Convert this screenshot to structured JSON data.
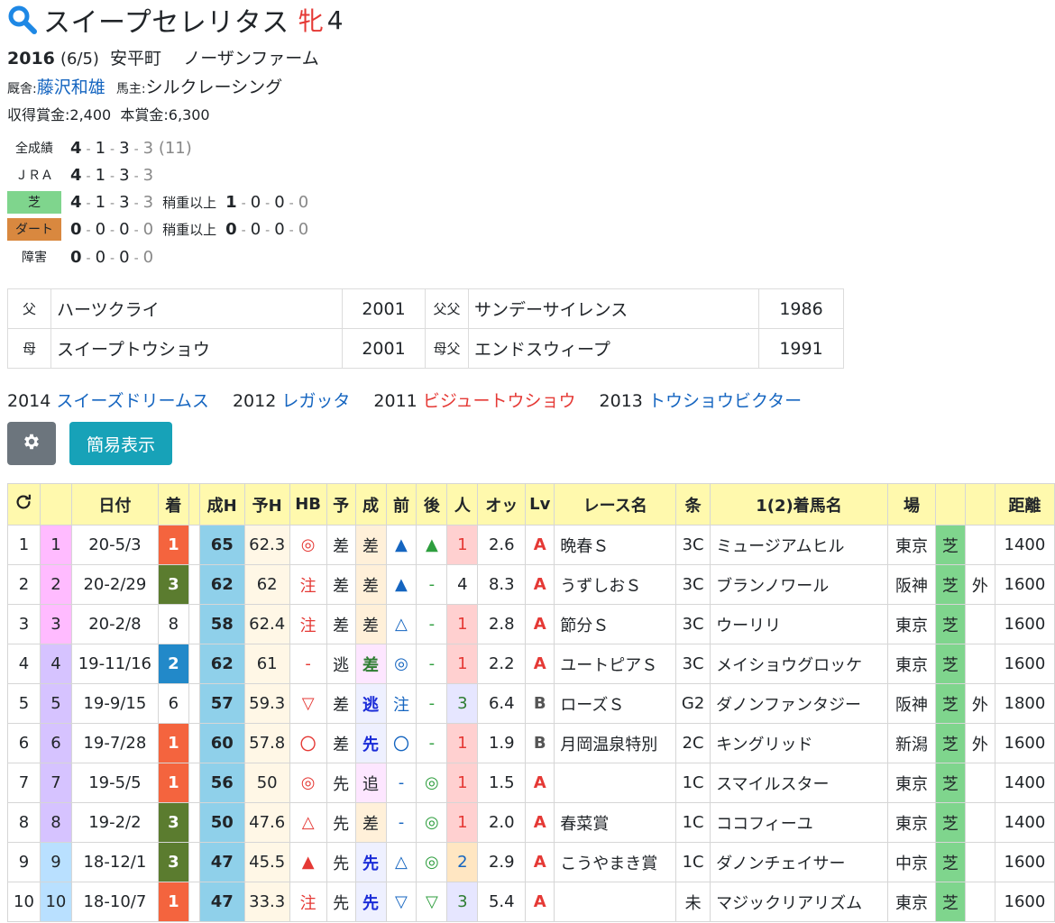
{
  "horse": {
    "name": "スイープセレリタス",
    "sex": "牝",
    "age": "4",
    "birth_year": "2016",
    "birth_date": "(6/5)",
    "birthplace": "安平町",
    "breeder": "ノーザンファーム",
    "trainer_label": "厩舎:",
    "trainer": "藤沢和雄",
    "owner_label": "馬主:",
    "owner": "シルクレーシング",
    "earnings_label": "収得賞金:",
    "earnings": "2,400",
    "prize_label": "本賞金:",
    "prize": "6,300"
  },
  "records": {
    "all": {
      "label": "全成績",
      "w": "4",
      "p2": "1",
      "p3": "3",
      "other": "3",
      "total": "(11)"
    },
    "jra": {
      "label": "ＪＲＡ",
      "w": "4",
      "p2": "1",
      "p3": "3",
      "other": "3"
    },
    "turf": {
      "label": "芝",
      "w": "4",
      "p2": "1",
      "p3": "3",
      "other": "3",
      "heavy_label": "稍重以上",
      "hw": "1",
      "h2": "0",
      "h3": "0",
      "ho": "0"
    },
    "dirt": {
      "label": "ダート",
      "w": "0",
      "p2": "0",
      "p3": "0",
      "other": "0",
      "heavy_label": "稍重以上",
      "hw": "0",
      "h2": "0",
      "h3": "0",
      "ho": "0"
    },
    "jump": {
      "label": "障害",
      "w": "0",
      "p2": "0",
      "p3": "0",
      "other": "0"
    }
  },
  "pedigree": {
    "sire_label": "父",
    "sire": "ハーツクライ",
    "sire_year": "2001",
    "ss_label": "父父",
    "ss": "サンデーサイレンス",
    "ss_year": "1986",
    "dam_label": "母",
    "dam": "スイープトウショウ",
    "dam_year": "2001",
    "ds_label": "母父",
    "ds": "エンドスウィープ",
    "ds_year": "1991"
  },
  "siblings": [
    {
      "year": "2014",
      "name": "スイーズドリームス",
      "color": "blue"
    },
    {
      "year": "2012",
      "name": "レガッタ",
      "color": "blue"
    },
    {
      "year": "2011",
      "name": "ビジュートウショウ",
      "color": "red"
    },
    {
      "year": "2013",
      "name": "トウショウビクター",
      "color": "blue"
    }
  ],
  "buttons": {
    "simple": "簡易表示",
    "settings_icon": "gear-icon"
  },
  "table": {
    "headers": {
      "refresh_icon": "refresh-icon",
      "date": "日付",
      "place": "着",
      "seih": "成H",
      "yoh": "予H",
      "hb": "HB",
      "yo": "予",
      "sei": "成",
      "mae": "前",
      "ato": "後",
      "pop": "人",
      "odds": "オッ",
      "lv": "Lv",
      "race": "レース名",
      "cond": "条",
      "winner": "1(2)着馬名",
      "venue": "場",
      "dist": "距離"
    },
    "rows": [
      {
        "no": "1",
        "idx": "1",
        "date": "20-5/3",
        "place": "1",
        "seih": "65",
        "yoh": "62.3",
        "hb": "◎",
        "yo": "差",
        "sei": "差",
        "mae": "▲",
        "ato": "▲",
        "pop": "1",
        "odds": "2.6",
        "lv": "A",
        "race": "晩春Ｓ",
        "cond": "3C",
        "winner": "ミュージアムヒル",
        "venue": "東京",
        "surface": "芝",
        "inout": "",
        "dist": "1400"
      },
      {
        "no": "2",
        "idx": "2",
        "date": "20-2/29",
        "place": "3",
        "seih": "62",
        "yoh": "62",
        "hb": "注",
        "yo": "差",
        "sei": "差",
        "mae": "▲",
        "ato": "-",
        "pop": "4",
        "odds": "8.3",
        "lv": "A",
        "race": "うずしおＳ",
        "cond": "3C",
        "winner": "ブランノワール",
        "venue": "阪神",
        "surface": "芝",
        "inout": "外",
        "dist": "1600"
      },
      {
        "no": "3",
        "idx": "3",
        "date": "20-2/8",
        "place": "8",
        "seih": "58",
        "yoh": "62.4",
        "hb": "注",
        "yo": "差",
        "sei": "差",
        "mae": "△",
        "ato": "-",
        "pop": "1",
        "odds": "2.8",
        "lv": "A",
        "race": "節分Ｓ",
        "cond": "3C",
        "winner": "ウーリリ",
        "venue": "東京",
        "surface": "芝",
        "inout": "",
        "dist": "1600"
      },
      {
        "no": "4",
        "idx": "4",
        "date": "19-11/16",
        "place": "2",
        "seih": "62",
        "yoh": "61",
        "hb": "-",
        "yo": "逃",
        "sei": "差",
        "mae": "◎",
        "ato": "-",
        "pop": "1",
        "odds": "2.2",
        "lv": "A",
        "race": "ユートピアＳ",
        "cond": "3C",
        "winner": "メイショウグロッケ",
        "venue": "東京",
        "surface": "芝",
        "inout": "",
        "dist": "1600"
      },
      {
        "no": "5",
        "idx": "5",
        "date": "19-9/15",
        "place": "6",
        "seih": "57",
        "yoh": "59.3",
        "hb": "▽",
        "yo": "差",
        "sei": "逃",
        "mae": "注",
        "ato": "-",
        "pop": "3",
        "odds": "6.4",
        "lv": "B",
        "race": "ローズＳ",
        "cond": "G2",
        "winner": "ダノンファンタジー",
        "venue": "阪神",
        "surface": "芝",
        "inout": "外",
        "dist": "1800"
      },
      {
        "no": "6",
        "idx": "6",
        "date": "19-7/28",
        "place": "1",
        "seih": "60",
        "yoh": "57.8",
        "hb": "〇",
        "yo": "差",
        "sei": "先",
        "mae": "〇",
        "ato": "-",
        "pop": "1",
        "odds": "1.9",
        "lv": "B",
        "race": "月岡温泉特別",
        "cond": "2C",
        "winner": "キングリッド",
        "venue": "新潟",
        "surface": "芝",
        "inout": "外",
        "dist": "1600"
      },
      {
        "no": "7",
        "idx": "7",
        "date": "19-5/5",
        "place": "1",
        "seih": "56",
        "yoh": "50",
        "hb": "◎",
        "yo": "先",
        "sei": "追",
        "mae": "-",
        "ato": "◎",
        "pop": "1",
        "odds": "1.5",
        "lv": "A",
        "race": "",
        "cond": "1C",
        "winner": "スマイルスター",
        "venue": "東京",
        "surface": "芝",
        "inout": "",
        "dist": "1400"
      },
      {
        "no": "8",
        "idx": "8",
        "date": "19-2/2",
        "place": "3",
        "seih": "50",
        "yoh": "47.6",
        "hb": "△",
        "yo": "先",
        "sei": "差",
        "mae": "-",
        "ato": "◎",
        "pop": "1",
        "odds": "2.0",
        "lv": "A",
        "race": "春菜賞",
        "cond": "1C",
        "winner": "ココフィーユ",
        "venue": "東京",
        "surface": "芝",
        "inout": "",
        "dist": "1400"
      },
      {
        "no": "9",
        "idx": "9",
        "date": "18-12/1",
        "place": "3",
        "seih": "47",
        "yoh": "45.5",
        "hb": "▲",
        "yo": "先",
        "sei": "先",
        "mae": "△",
        "ato": "◎",
        "pop": "2",
        "odds": "2.9",
        "lv": "A",
        "race": "こうやまき賞",
        "cond": "1C",
        "winner": "ダノンチェイサー",
        "venue": "中京",
        "surface": "芝",
        "inout": "",
        "dist": "1600"
      },
      {
        "no": "10",
        "idx": "10",
        "date": "18-10/7",
        "place": "1",
        "seih": "47",
        "yoh": "33.3",
        "hb": "注",
        "yo": "先",
        "sei": "先",
        "mae": "▽",
        "ato": "▽",
        "pop": "3",
        "odds": "5.4",
        "lv": "A",
        "race": "",
        "cond": "未",
        "winner": "マジックリアリズム",
        "venue": "東京",
        "surface": "芝",
        "inout": "",
        "dist": "1600"
      }
    ]
  },
  "colors": {
    "accent_blue": "#1565c0",
    "accent_red": "#e53935",
    "header_yellow": "#fff9ad",
    "turf_green": "#7fd58d",
    "dirt_brown": "#d9883f",
    "btn_grey": "#6c757d",
    "btn_teal": "#17a2b8"
  }
}
